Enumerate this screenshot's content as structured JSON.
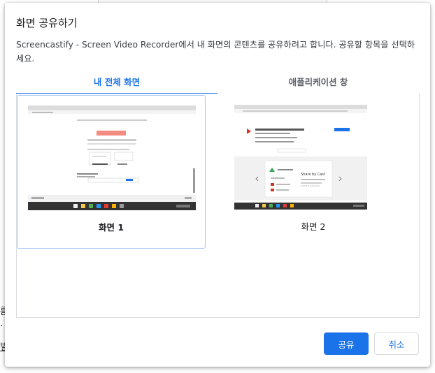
{
  "dialog": {
    "title": "화면 공유하기",
    "description": "Screencastify - Screen Video Recorder에서 내 화면의 콘텐츠를 공유하려고 합니다. 공유할 항목을 선택하세요.",
    "tabs": [
      {
        "label": "내 전체 화면",
        "active": true
      },
      {
        "label": "애플리케이션 창",
        "active": false
      }
    ],
    "screens": [
      {
        "label": "화면 1",
        "selected": true
      },
      {
        "label": "화면 2",
        "selected": false
      }
    ],
    "buttons": {
      "share": "공유",
      "cancel": "취소"
    }
  },
  "background": {
    "fragments": [
      "름",
      "·",
      "빌"
    ]
  },
  "colors": {
    "accent": "#1a73e8",
    "selection_border": "#a8c7fa",
    "divider": "#dadce0"
  },
  "thumbnail2": {
    "headline": "Share by Cast",
    "subtitle": "Add this extension"
  }
}
